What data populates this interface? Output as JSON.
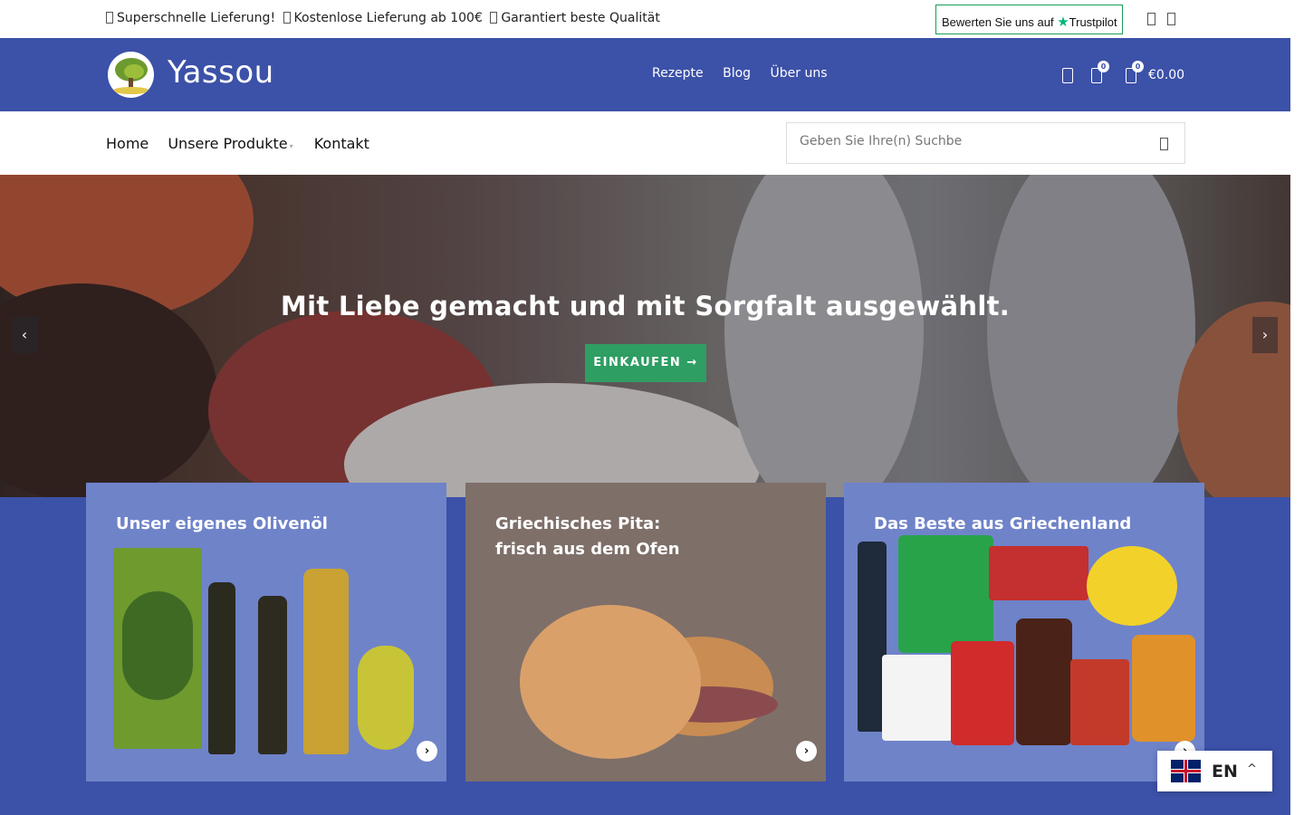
{
  "topbar": {
    "promos": [
      "Superschnelle Lieferung!",
      "Kostenlose Lieferung ab 100€",
      "Garantiert beste Qualität"
    ],
    "trustpilot_prefix": "Bewerten Sie uns auf",
    "trustpilot_brand": "Trustpilot"
  },
  "header": {
    "logo_text": "Yassou",
    "nav": [
      "Rezepte",
      "Blog",
      "Über uns"
    ],
    "wishlist_count": "0",
    "cart_count": "0",
    "cart_total": "€0.00"
  },
  "subnav": {
    "links": [
      "Home",
      "Unsere Produkte",
      "Kontakt"
    ],
    "search_placeholder": "Geben Sie Ihre(n) Suchbe"
  },
  "hero": {
    "headline": "Mit Liebe gemacht und mit Sorgfalt ausgewählt.",
    "cta": "EINKAUFEN →"
  },
  "cards": [
    {
      "title_line1": "Unser eigenes Olivenöl",
      "title_line2": ""
    },
    {
      "title_line1": "Griechisches Pita:",
      "title_line2": "frisch aus dem Ofen"
    },
    {
      "title_line1": "Das Beste aus Griechenland",
      "title_line2": ""
    }
  ],
  "language": {
    "code": "EN"
  },
  "colors": {
    "brand_blue": "#3c51a8",
    "cta_green": "#2f9e63",
    "trustpilot_green": "#00b67a"
  }
}
